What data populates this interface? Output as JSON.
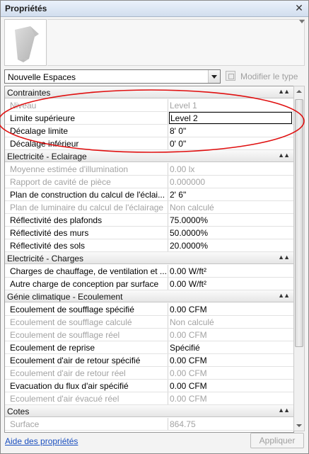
{
  "window": {
    "title": "Propriétés",
    "close_label": "✕"
  },
  "type_selector": {
    "value": "Nouvelle Espaces",
    "edit_type_label": "Modifier le type"
  },
  "groups": [
    {
      "name": "Contraintes",
      "rows": [
        {
          "name": "Niveau",
          "value": "Level 1",
          "disabled": true
        },
        {
          "name": "Limite supérieure",
          "value": "Level 2",
          "editing": true
        },
        {
          "name": "Décalage limite",
          "value": "8'  0\""
        },
        {
          "name": "Décalage inférieur",
          "value": "0'  0\""
        }
      ]
    },
    {
      "name": "Electricité - Eclairage",
      "rows": [
        {
          "name": "Moyenne estimée d'illumination",
          "value": "0.00 lx",
          "disabled": true
        },
        {
          "name": "Rapport de cavité de pièce",
          "value": "0.000000",
          "disabled": true
        },
        {
          "name": "Plan de construction du calcul de l'éclai...",
          "value": "2'  6\""
        },
        {
          "name": "Plan de luminaire du calcul de l'éclairage",
          "value": "Non calculé",
          "disabled": true
        },
        {
          "name": "Réflectivité des plafonds",
          "value": "75.0000%"
        },
        {
          "name": "Réflectivité des murs",
          "value": "50.0000%"
        },
        {
          "name": "Réflectivité des sols",
          "value": "20.0000%"
        }
      ]
    },
    {
      "name": "Electricité - Charges",
      "rows": [
        {
          "name": "Charges de chauffage, de ventilation et ...",
          "value": "0.00 W/ft²"
        },
        {
          "name": "Autre charge de conception par surface",
          "value": "0.00 W/ft²"
        }
      ]
    },
    {
      "name": "Génie climatique - Ecoulement",
      "rows": [
        {
          "name": "Ecoulement de soufflage spécifié",
          "value": "0.00 CFM"
        },
        {
          "name": "Ecoulement de soufflage calculé",
          "value": "Non calculé",
          "disabled": true
        },
        {
          "name": "Ecoulement de soufflage réel",
          "value": "0.00 CFM",
          "disabled": true
        },
        {
          "name": "Ecoulement de reprise",
          "value": "Spécifié"
        },
        {
          "name": "Ecoulement d'air de retour spécifié",
          "value": "0.00 CFM"
        },
        {
          "name": "Ecoulement d'air de retour réel",
          "value": "0.00 CFM",
          "disabled": true
        },
        {
          "name": "Evacuation du flux d'air spécifié",
          "value": "0.00 CFM"
        },
        {
          "name": "Ecoulement d'air évacué réel",
          "value": "0.00 CFM",
          "disabled": true
        }
      ]
    },
    {
      "name": "Cotes",
      "rows": [
        {
          "name": "Surface",
          "value": "864.75",
          "disabled": true
        }
      ]
    }
  ],
  "collapse_glyph": "▲▲",
  "footer": {
    "help_link": "Aide des propriétés",
    "apply_label": "Appliquer"
  },
  "colors": {
    "annotation_ellipse": "#e01010",
    "link": "#1a4fbf"
  }
}
